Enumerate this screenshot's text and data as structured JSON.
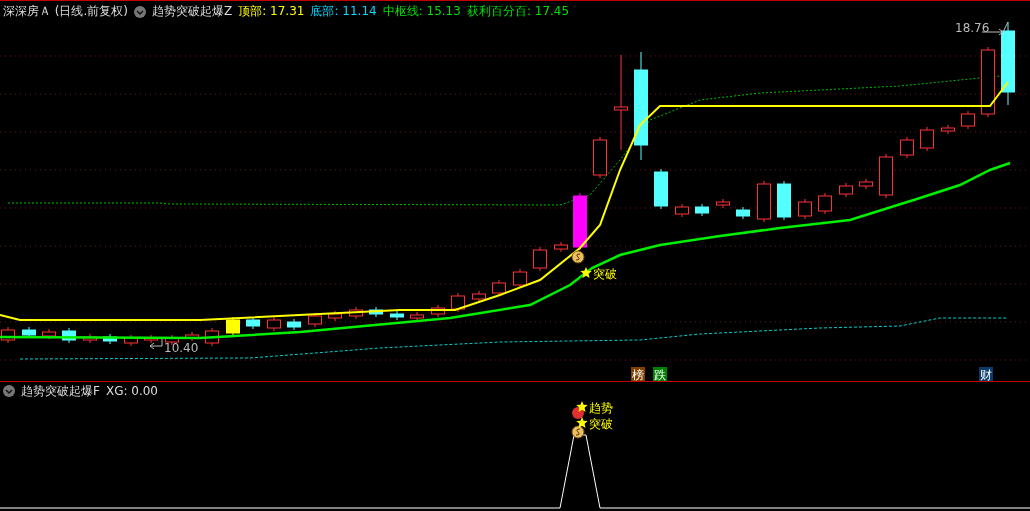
{
  "header": {
    "security": "深深房Ａ (日线.前复权)",
    "indicator": "趋势突破起爆Z",
    "metrics": [
      {
        "label": "顶部:",
        "value": "17.31",
        "color": "#ffff00"
      },
      {
        "label": "底部:",
        "value": "11.14",
        "color": "#00d8ff"
      },
      {
        "label": "中枢线:",
        "value": "15.13",
        "color": "#00e000"
      },
      {
        "label": "获利百分百:",
        "value": "17.45",
        "color": "#00e000"
      }
    ]
  },
  "price_chart": {
    "high_label": "18.76",
    "low_label": "10.40",
    "signals": [
      {
        "kind": "breakout",
        "label": "突破"
      }
    ],
    "events": [
      {
        "label": "榜",
        "color": "#804000"
      },
      {
        "label": "跌",
        "color": "#008000"
      },
      {
        "label": "财",
        "color": "#0a3a6a"
      }
    ]
  },
  "sub_chart": {
    "title": "趋势突破起爆F",
    "reading": "XG: 0.00",
    "signals": [
      {
        "kind": "trend",
        "label": "趋势"
      },
      {
        "kind": "breakout",
        "label": "突破"
      }
    ]
  }
}
